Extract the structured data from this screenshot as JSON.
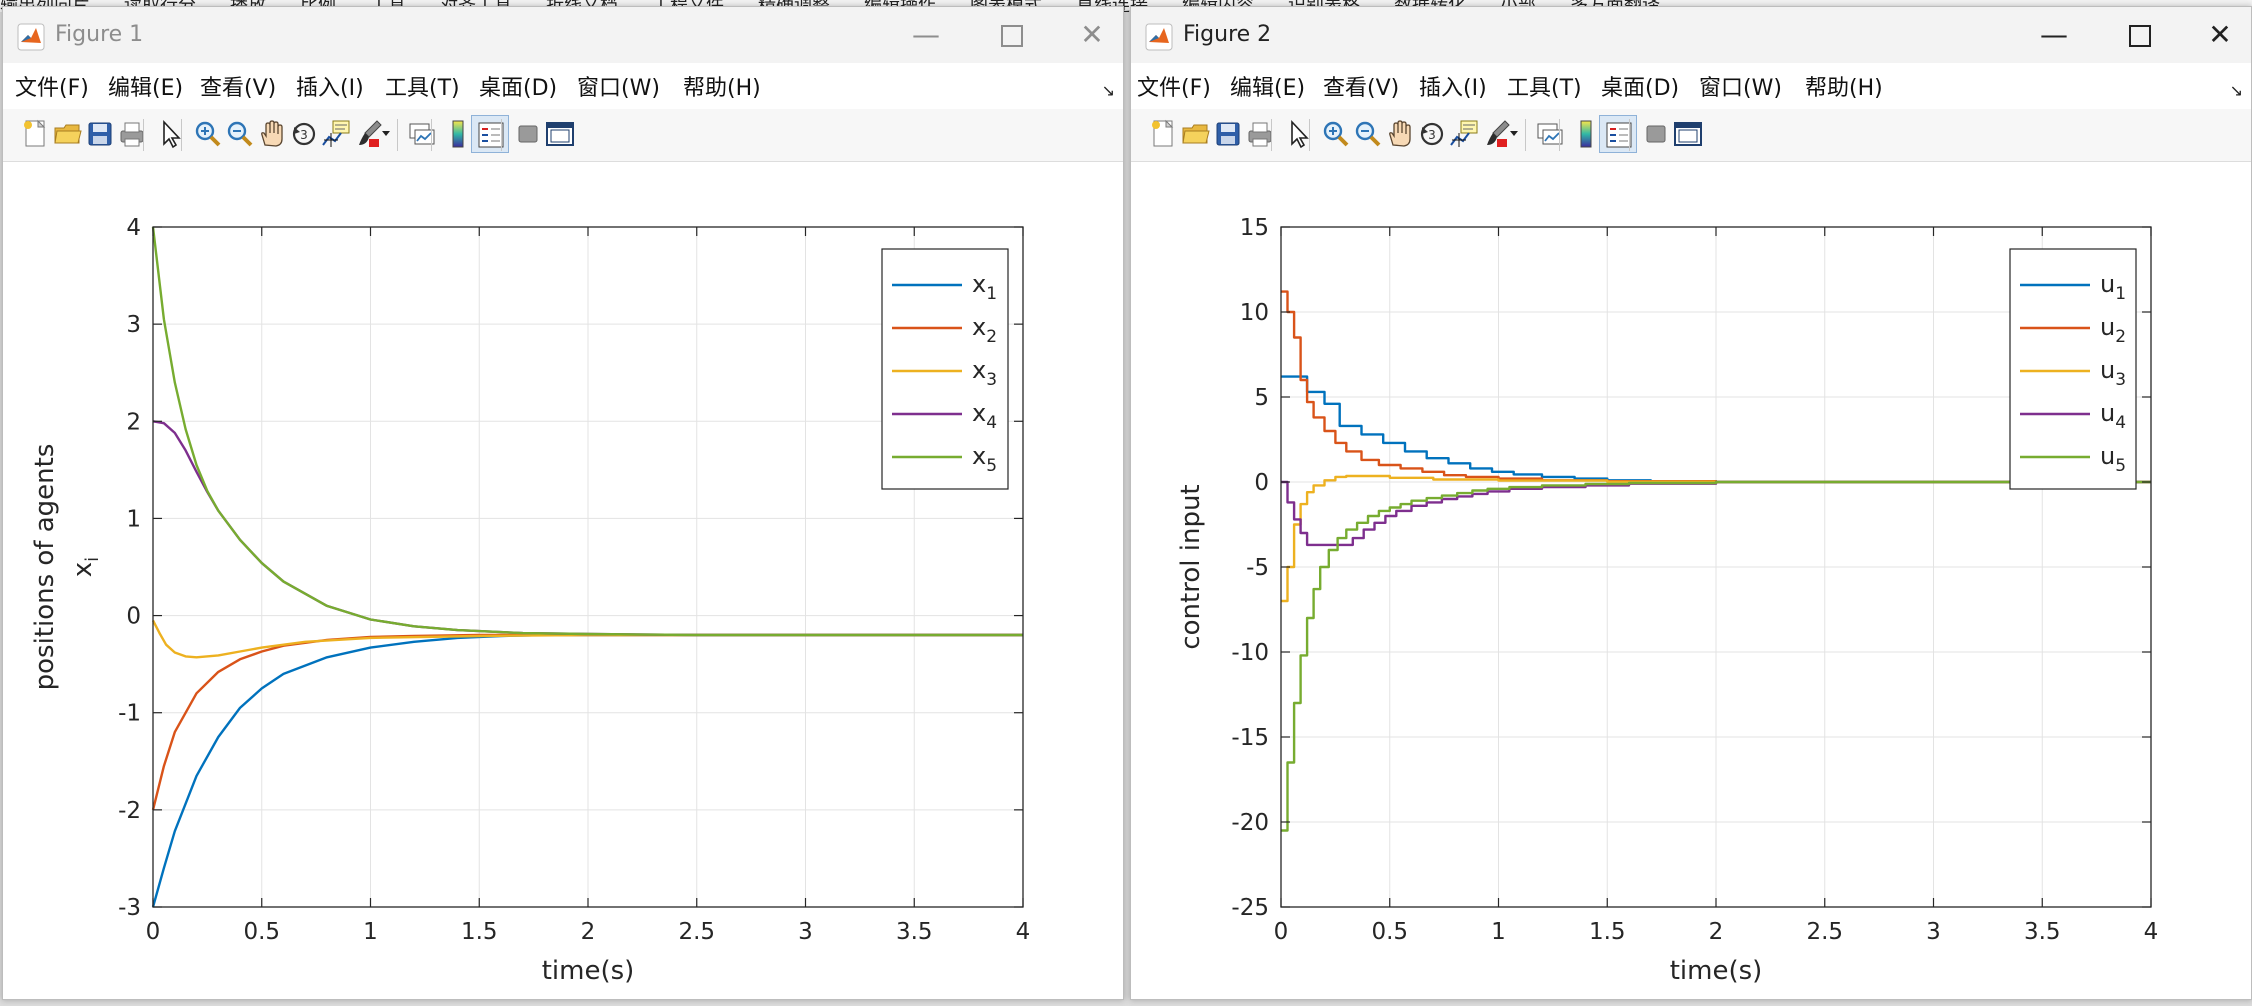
{
  "background_text": [
    "输出列向片",
    "读取行分",
    "播放",
    "比例",
    "工具",
    "对齐工具",
    "折线文档",
    "工程文件",
    "精确调整",
    "编辑操作",
    "图表模式",
    "直线连接",
    "编辑内容",
    "识别表格",
    "数据转化",
    "小部",
    "多方面翻译"
  ],
  "menu": [
    "文件(F)",
    "编辑(E)",
    "查看(V)",
    "插入(I)",
    "工具(T)",
    "桌面(D)",
    "窗口(W)",
    "帮助(H)"
  ],
  "toolbar_icons": [
    "new-figure-icon",
    "open-file-icon",
    "save-icon",
    "print-icon",
    "select-arrow-icon",
    "zoom-in-icon",
    "zoom-out-icon",
    "pan-hand-icon",
    "rotate-3d-icon",
    "data-cursor-icon",
    "brush-icon",
    "brush-dropdown-icon",
    "link-plot-icon",
    "colorbar-icon",
    "legend-icon",
    "hide-plot-tools-icon",
    "show-plot-tools-icon"
  ],
  "colors": {
    "s1": "#0072BD",
    "s2": "#D95319",
    "s3": "#EDB120",
    "s4": "#7E2F8E",
    "s5": "#77AC30",
    "grid": "#e3e3e3"
  },
  "figures": [
    {
      "title": "Figure 1",
      "inactive": true,
      "chart_data": {
        "type": "line",
        "xlabel": "time(s)",
        "ylabel": "positions of agents",
        "ylabel2_base": "x",
        "ylabel2_sub": "i",
        "xlim": [
          0,
          4
        ],
        "ylim": [
          -3,
          4
        ],
        "xticks": [
          0,
          0.5,
          1,
          1.5,
          2,
          2.5,
          3,
          3.5,
          4
        ],
        "xtick_labels": [
          "0",
          "0.5",
          "1",
          "1.5",
          "2",
          "2.5",
          "3",
          "3.5",
          "4"
        ],
        "yticks": [
          -3,
          -2,
          -1,
          0,
          1,
          2,
          3,
          4
        ],
        "ytick_labels": [
          "-3",
          "-2",
          "-1",
          "0",
          "1",
          "2",
          "3",
          "4"
        ],
        "grid": true,
        "legend_position": "top-right",
        "step": false,
        "series": [
          {
            "label_base": "x",
            "label_sub": "1",
            "x": [
              0,
              0.05,
              0.1,
              0.2,
              0.3,
              0.4,
              0.5,
              0.6,
              0.8,
              1.0,
              1.2,
              1.4,
              1.6,
              1.8,
              2.0,
              2.5,
              3.0,
              4.0
            ],
            "y": [
              -3.0,
              -2.6,
              -2.22,
              -1.65,
              -1.25,
              -0.95,
              -0.75,
              -0.6,
              -0.43,
              -0.33,
              -0.27,
              -0.23,
              -0.21,
              -0.2,
              -0.2,
              -0.2,
              -0.2,
              -0.2
            ]
          },
          {
            "label_base": "x",
            "label_sub": "2",
            "x": [
              0,
              0.05,
              0.1,
              0.2,
              0.3,
              0.4,
              0.5,
              0.6,
              0.8,
              1.0,
              1.2,
              1.5,
              2.0,
              2.5,
              4.0
            ],
            "y": [
              -2.0,
              -1.55,
              -1.2,
              -0.8,
              -0.58,
              -0.45,
              -0.37,
              -0.31,
              -0.25,
              -0.22,
              -0.21,
              -0.2,
              -0.2,
              -0.2,
              -0.2
            ]
          },
          {
            "label_base": "x",
            "label_sub": "3",
            "x": [
              0,
              0.03,
              0.06,
              0.1,
              0.15,
              0.2,
              0.3,
              0.4,
              0.5,
              0.7,
              1.0,
              1.5,
              2.0,
              4.0
            ],
            "y": [
              -0.05,
              -0.18,
              -0.3,
              -0.38,
              -0.42,
              -0.43,
              -0.41,
              -0.37,
              -0.33,
              -0.27,
              -0.23,
              -0.21,
              -0.2,
              -0.2
            ]
          },
          {
            "label_base": "x",
            "label_sub": "4",
            "x": [
              0,
              0.05,
              0.1,
              0.15,
              0.2,
              0.25,
              0.3,
              0.4,
              0.5,
              0.6,
              0.8,
              1.0,
              1.2,
              1.4,
              1.7,
              2.0,
              2.5,
              4.0
            ],
            "y": [
              2.0,
              1.98,
              1.88,
              1.7,
              1.48,
              1.27,
              1.08,
              0.78,
              0.54,
              0.35,
              0.1,
              -0.04,
              -0.11,
              -0.15,
              -0.18,
              -0.19,
              -0.2,
              -0.2
            ]
          },
          {
            "label_base": "x",
            "label_sub": "5",
            "x": [
              0,
              0.05,
              0.1,
              0.15,
              0.2,
              0.25,
              0.3,
              0.4,
              0.5,
              0.6,
              0.8,
              1.0,
              1.2,
              1.4,
              1.7,
              2.0,
              2.5,
              4.0
            ],
            "y": [
              4.0,
              3.05,
              2.4,
              1.92,
              1.55,
              1.28,
              1.08,
              0.78,
              0.54,
              0.35,
              0.1,
              -0.04,
              -0.11,
              -0.15,
              -0.18,
              -0.19,
              -0.2,
              -0.2
            ]
          }
        ]
      }
    },
    {
      "title": "Figure 2",
      "inactive": false,
      "chart_data": {
        "type": "line",
        "xlabel": "time(s)",
        "ylabel": "control input",
        "ylabel2_base": "",
        "ylabel2_sub": "",
        "xlim": [
          0,
          4
        ],
        "ylim": [
          -25,
          15
        ],
        "xticks": [
          0,
          0.5,
          1,
          1.5,
          2,
          2.5,
          3,
          3.5,
          4
        ],
        "xtick_labels": [
          "0",
          "0.5",
          "1",
          "1.5",
          "2",
          "2.5",
          "3",
          "3.5",
          "4"
        ],
        "yticks": [
          -25,
          -20,
          -15,
          -10,
          -5,
          0,
          5,
          10,
          15
        ],
        "ytick_labels": [
          "-25",
          "-20",
          "-15",
          "-10",
          "-5",
          "0",
          "5",
          "10",
          "15"
        ],
        "grid": true,
        "legend_position": "top-right",
        "step": true,
        "series": [
          {
            "label_base": "u",
            "label_sub": "1",
            "x": [
              0,
              0.12,
              0.2,
              0.27,
              0.37,
              0.47,
              0.57,
              0.67,
              0.77,
              0.87,
              0.97,
              1.07,
              1.2,
              1.35,
              1.5,
              1.7,
              2.0,
              4.0
            ],
            "y": [
              6.2,
              5.3,
              4.6,
              3.3,
              2.8,
              2.3,
              1.8,
              1.4,
              1.1,
              0.8,
              0.6,
              0.45,
              0.3,
              0.2,
              0.1,
              0.05,
              0.0,
              0.0
            ]
          },
          {
            "label_base": "u",
            "label_sub": "2",
            "x": [
              0,
              0.03,
              0.06,
              0.09,
              0.12,
              0.15,
              0.2,
              0.25,
              0.3,
              0.37,
              0.45,
              0.55,
              0.65,
              0.75,
              0.85,
              1.0,
              1.2,
              1.5,
              2.0,
              4.0
            ],
            "y": [
              11.2,
              10.0,
              8.5,
              6.0,
              4.7,
              3.8,
              3.0,
              2.3,
              1.8,
              1.3,
              1.0,
              0.8,
              0.6,
              0.4,
              0.3,
              0.2,
              0.1,
              0.05,
              0.0,
              0.0
            ]
          },
          {
            "label_base": "u",
            "label_sub": "3",
            "x": [
              0,
              0.03,
              0.06,
              0.09,
              0.12,
              0.15,
              0.2,
              0.25,
              0.3,
              0.5,
              0.7,
              1.0,
              1.5,
              2.0,
              4.0
            ],
            "y": [
              -7.0,
              -5.0,
              -2.5,
              -1.3,
              -0.6,
              -0.2,
              0.1,
              0.3,
              0.35,
              0.25,
              0.15,
              0.08,
              0.02,
              0.0,
              0.0
            ]
          },
          {
            "label_base": "u",
            "label_sub": "4",
            "x": [
              0,
              0.03,
              0.06,
              0.09,
              0.12,
              0.33,
              0.38,
              0.43,
              0.48,
              0.53,
              0.6,
              0.67,
              0.74,
              0.81,
              0.88,
              0.95,
              1.05,
              1.2,
              1.4,
              1.6,
              2.0,
              4.0
            ],
            "y": [
              0.0,
              -1.2,
              -2.2,
              -3.0,
              -3.7,
              -3.3,
              -2.8,
              -2.4,
              -2.0,
              -1.7,
              -1.4,
              -1.2,
              -1.0,
              -0.85,
              -0.7,
              -0.55,
              -0.4,
              -0.3,
              -0.2,
              -0.1,
              0.0,
              0.0
            ]
          },
          {
            "label_base": "u",
            "label_sub": "5",
            "x": [
              0,
              0.03,
              0.06,
              0.09,
              0.12,
              0.15,
              0.18,
              0.22,
              0.26,
              0.3,
              0.35,
              0.4,
              0.45,
              0.5,
              0.55,
              0.6,
              0.67,
              0.74,
              0.81,
              0.88,
              0.95,
              1.05,
              1.2,
              1.4,
              1.6,
              2.0,
              4.0
            ],
            "y": [
              -20.5,
              -16.5,
              -13.0,
              -10.2,
              -8.0,
              -6.3,
              -5.0,
              -4.0,
              -3.3,
              -2.8,
              -2.4,
              -2.0,
              -1.7,
              -1.5,
              -1.3,
              -1.1,
              -0.95,
              -0.8,
              -0.65,
              -0.5,
              -0.4,
              -0.3,
              -0.2,
              -0.12,
              -0.06,
              0.0,
              0.0
            ]
          }
        ]
      }
    }
  ]
}
